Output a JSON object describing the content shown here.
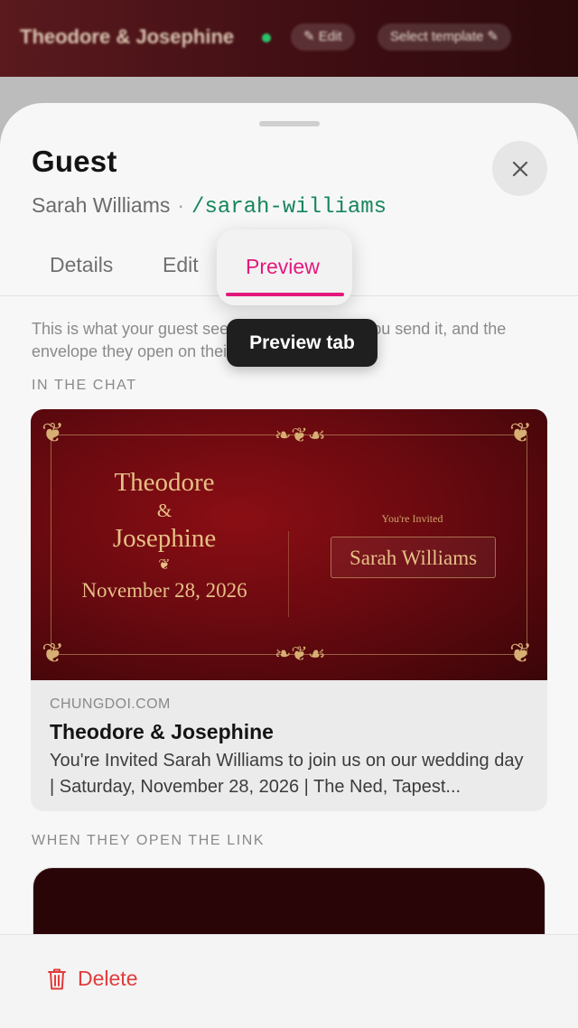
{
  "background": {
    "event_title": "Theodore & Josephine",
    "edit_label": "Edit",
    "select_template_label": "Select template"
  },
  "sheet": {
    "title": "Guest",
    "guest_name": "Sarah Williams",
    "separator": "·",
    "slug": "/sarah-williams",
    "tabs": [
      {
        "label": "Details"
      },
      {
        "label": "Edit"
      },
      {
        "label": "Preview",
        "active": true
      }
    ],
    "tooltip": "Preview tab",
    "intro": "This is what your guest sees in the chat when you send it, and the envelope they open on their own link.",
    "chat_section_label": "IN THE CHAT",
    "link_section_label": "WHEN THEY OPEN THE LINK"
  },
  "invite_card": {
    "name1": "Theodore",
    "amp": "&",
    "name2": "Josephine",
    "flourish": "❦",
    "date": "November 28, 2026",
    "invited_label": "You're Invited",
    "guest": "Sarah Williams"
  },
  "link_preview": {
    "domain": "CHUNGDOI.COM",
    "title": "Theodore & Josephine",
    "description": "You're Invited Sarah Williams to join us on our wedding day | Saturday, November 28, 2026 | The Ned, Tapest..."
  },
  "footer": {
    "delete_label": "Delete"
  },
  "colors": {
    "accent": "#e3197d",
    "slug": "#17855c",
    "danger": "#e23b3b",
    "invite_red": "#7a0c12",
    "gold": "#d7ae73"
  }
}
